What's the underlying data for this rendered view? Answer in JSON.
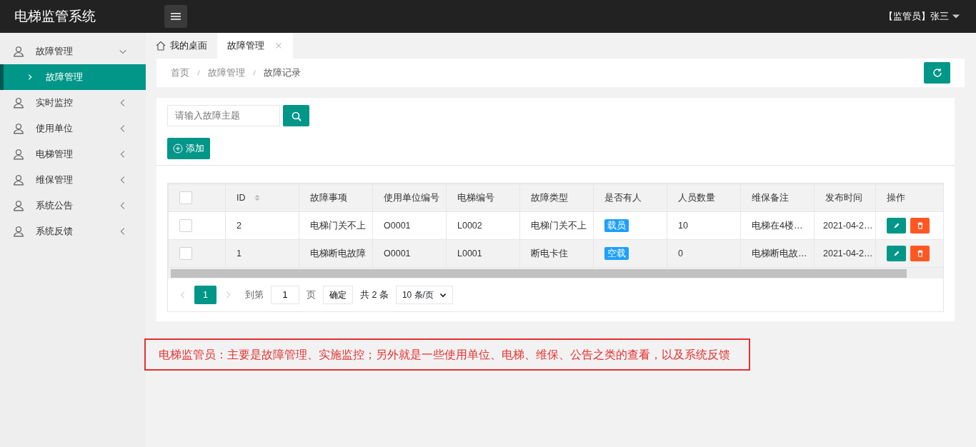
{
  "header": {
    "title": "电梯监管系统",
    "user_role": "【监管员】",
    "user_name": "张三"
  },
  "sidebar": {
    "items": [
      {
        "label": "故障管理",
        "expanded": true,
        "children": [
          {
            "label": "故障管理",
            "selected": true
          }
        ]
      },
      {
        "label": "实时监控",
        "expanded": false
      },
      {
        "label": "使用单位",
        "expanded": false
      },
      {
        "label": "电梯管理",
        "expanded": false
      },
      {
        "label": "维保管理",
        "expanded": false
      },
      {
        "label": "系统公告",
        "expanded": false
      },
      {
        "label": "系统反馈",
        "expanded": false
      }
    ]
  },
  "tabs": [
    {
      "label": "我的桌面",
      "kind": "home",
      "selected": false
    },
    {
      "label": "故障管理",
      "kind": "closable",
      "selected": true
    }
  ],
  "breadcrumb": [
    "首页",
    "故障管理",
    "故障记录"
  ],
  "search": {
    "placeholder": "请输入故障主题"
  },
  "add_button": "添加",
  "table": {
    "select_all_checked": false,
    "columns": [
      "ID",
      "故障事项",
      "使用单位编号",
      "电梯编号",
      "故障类型",
      "是否有人",
      "人员数量",
      "维保备注",
      "发布时间",
      "操作"
    ],
    "rows": [
      {
        "checked": false,
        "cells": [
          "2",
          "电梯门关不上",
          "O0001",
          "L0002",
          "电梯门关不上",
          "载员",
          "10",
          "电梯在4楼…",
          "2021-04-2…"
        ]
      },
      {
        "checked": false,
        "cells": [
          "1",
          "电梯断电故障",
          "O0001",
          "L0001",
          "断电卡住",
          "空载",
          "0",
          "电梯断电故…",
          "2021-04-2…"
        ]
      }
    ]
  },
  "pagination": {
    "pages": [
      {
        "label": "1",
        "selected": true
      }
    ],
    "goto_label": "到第",
    "goto_value": "1",
    "page_unit": "页",
    "confirm": "确定",
    "total": "共 2 条",
    "page_size": "10 条/页"
  },
  "note": "电梯监管员：主要是故障管理、实施监控；另外就是一些使用单位、电梯、维保、公告之类的查看，以及系统反馈"
}
